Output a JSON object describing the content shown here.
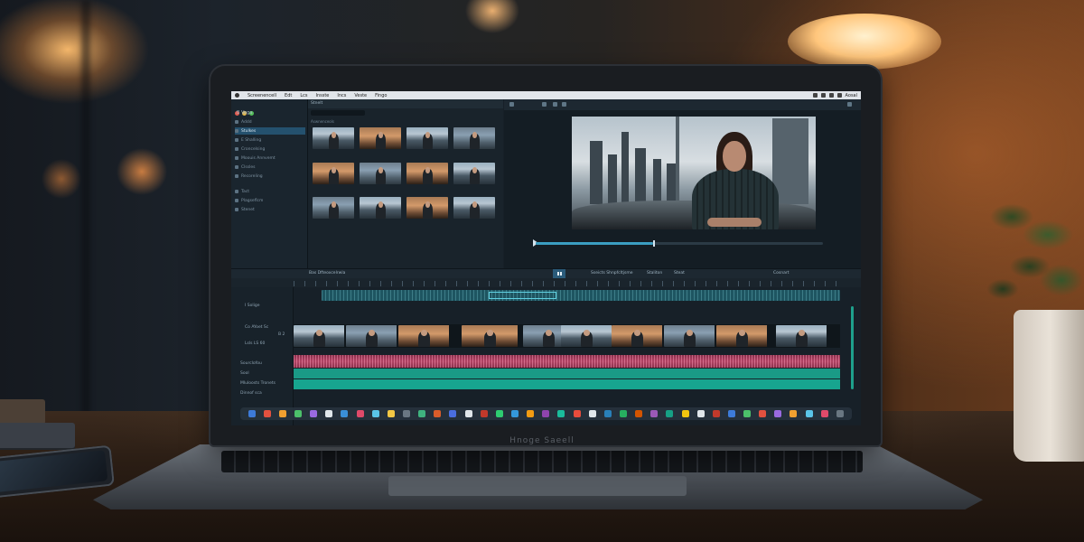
{
  "scene": {
    "laptop_brand": "Hnoge Saeell"
  },
  "screen": {
    "menubar": {
      "items": [
        "Screenencell",
        "Edt",
        "Lcs",
        "Insste",
        "Incs",
        "Veste",
        "Fingo"
      ],
      "clock": "Aosal"
    },
    "sidebar": {
      "title": "B Vega",
      "items": [
        {
          "label": "Addd",
          "active": false
        },
        {
          "label": "Stulkes",
          "active": true
        },
        {
          "label": "E Shalling",
          "active": false
        },
        {
          "label": "Croncelsing",
          "active": false
        },
        {
          "label": "Moouis Annvemt",
          "active": false
        },
        {
          "label": "Clssles",
          "active": false
        },
        {
          "label": "Recoreling",
          "active": false
        },
        {
          "label": "Tact",
          "active": false
        },
        {
          "label": "Plagseflcm",
          "active": false
        },
        {
          "label": "Stenet",
          "active": false
        }
      ]
    },
    "media": {
      "tab": "Stnelt",
      "label": "Aswnenceols"
    },
    "toolbar": {
      "center_text": "Sseicts Shnpfcltjsme",
      "secondary_text": "Staliton",
      "tertiary_text": "Steat",
      "right_text": "Cosnart",
      "left_text": "Bas Dfteoxcelrwla"
    },
    "timeline": {
      "track_labels": [
        "I Solige",
        "Co AYoet Sc",
        "Lsls LS 60",
        "Sourclofou",
        "Sool",
        "Mluloosts Tronets",
        "Dinnof sca"
      ],
      "corner_badge": "B 2"
    },
    "colors": {
      "accent": "#3b9ec2",
      "audio_red": "#b24465",
      "audio_teal": "#17a58f",
      "ui_dark": "#172028"
    }
  }
}
